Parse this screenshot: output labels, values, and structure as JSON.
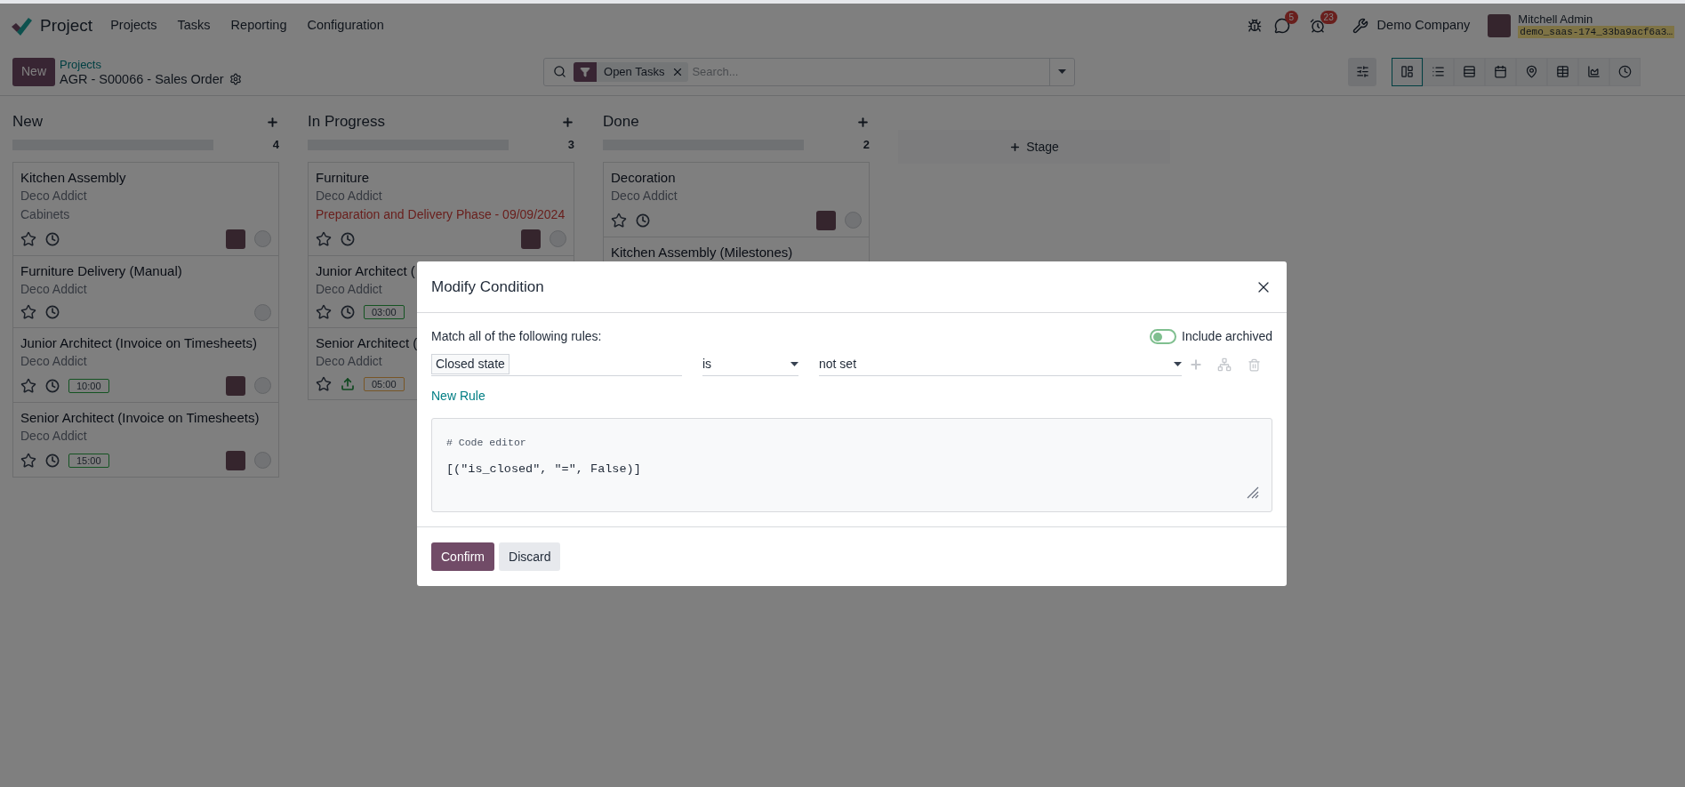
{
  "navbar": {
    "app_name": "Project",
    "menu": [
      "Projects",
      "Tasks",
      "Reporting",
      "Configuration"
    ],
    "messages_count": "5",
    "activities_count": "23",
    "company": "Demo Company",
    "user": "Mitchell Admin",
    "database": "demo_saas-174_33ba9acf6a3…"
  },
  "control_panel": {
    "new_button": "New",
    "breadcrumb": "Projects",
    "title": "AGR - S00066 - Sales Order"
  },
  "search": {
    "facet": "Open Tasks",
    "placeholder": "Search..."
  },
  "views": [
    {
      "kind": "kanban",
      "selected": true
    },
    {
      "kind": "list",
      "selected": false
    },
    {
      "kind": "gantt",
      "selected": false
    },
    {
      "kind": "calendar",
      "selected": false
    },
    {
      "kind": "map",
      "selected": false
    },
    {
      "kind": "pivot",
      "selected": false
    },
    {
      "kind": "graph",
      "selected": false
    },
    {
      "kind": "activity",
      "selected": false
    }
  ],
  "columns": [
    {
      "title": "New",
      "count": "4",
      "progress": {
        "level": 0
      },
      "cards": [
        {
          "kind": "clock",
          "title": "Kitchen Assembly",
          "customer": "Deco Addict",
          "note": {
            "kind": "tag",
            "text": "Cabinets"
          },
          "avatar": true
        },
        {
          "kind": "clock",
          "title": "Furniture Delivery (Manual)",
          "customer": "Deco Addict",
          "avatar": false
        },
        {
          "kind": "clock",
          "title": "Junior Architect (Invoice on Timesheets)",
          "customer": "Deco Addict",
          "hours": {
            "text": "10:00",
            "kind": "on_track"
          },
          "avatar": true
        },
        {
          "kind": "clock",
          "title": "Senior Architect (Invoice on Timesheets)",
          "customer": "Deco Addict",
          "hours": {
            "text": "15:00",
            "kind": "on_track"
          },
          "avatar": true
        }
      ]
    },
    {
      "title": "In Progress",
      "count": "3",
      "progress": {
        "level": 0
      },
      "cards": [
        {
          "kind": "clock",
          "title": "Furniture",
          "customer": "Deco Addict",
          "note": {
            "kind": "deadline",
            "text": "Preparation and Delivery Phase - 09/09/2024"
          },
          "avatar": true
        },
        {
          "kind": "clock",
          "title": "Junior Architect (",
          "customer": "Deco Addict",
          "hours": {
            "text": "03:00",
            "kind": "on_track"
          },
          "avatar": false
        },
        {
          "kind": "upload",
          "title": "Senior Architect (",
          "customer": "Deco Addict",
          "hours": {
            "text": "05:00",
            "kind": "warning"
          },
          "avatar": false
        }
      ]
    },
    {
      "title": "Done",
      "count": "2",
      "progress": {
        "level": 0
      },
      "cards": [
        {
          "kind": "clock",
          "title": "Decoration",
          "customer": "Deco Addict",
          "avatar": true
        },
        {
          "kind": "partial",
          "title": "Kitchen Assembly (Milestones)"
        }
      ]
    }
  ],
  "add_stage": "Stage",
  "dialog": {
    "title": "Modify Condition",
    "match_label": "Match all of the following rules:",
    "include_archived": {
      "label": "Include archived",
      "on": false
    },
    "rule": {
      "field": "Closed state",
      "operator": "is",
      "value": "not set"
    },
    "new_rule": "New Rule",
    "code_comment": "# Code editor",
    "code": "[(\"is_closed\", \"=\", False)]",
    "confirm": "Confirm",
    "discard": "Discard"
  }
}
